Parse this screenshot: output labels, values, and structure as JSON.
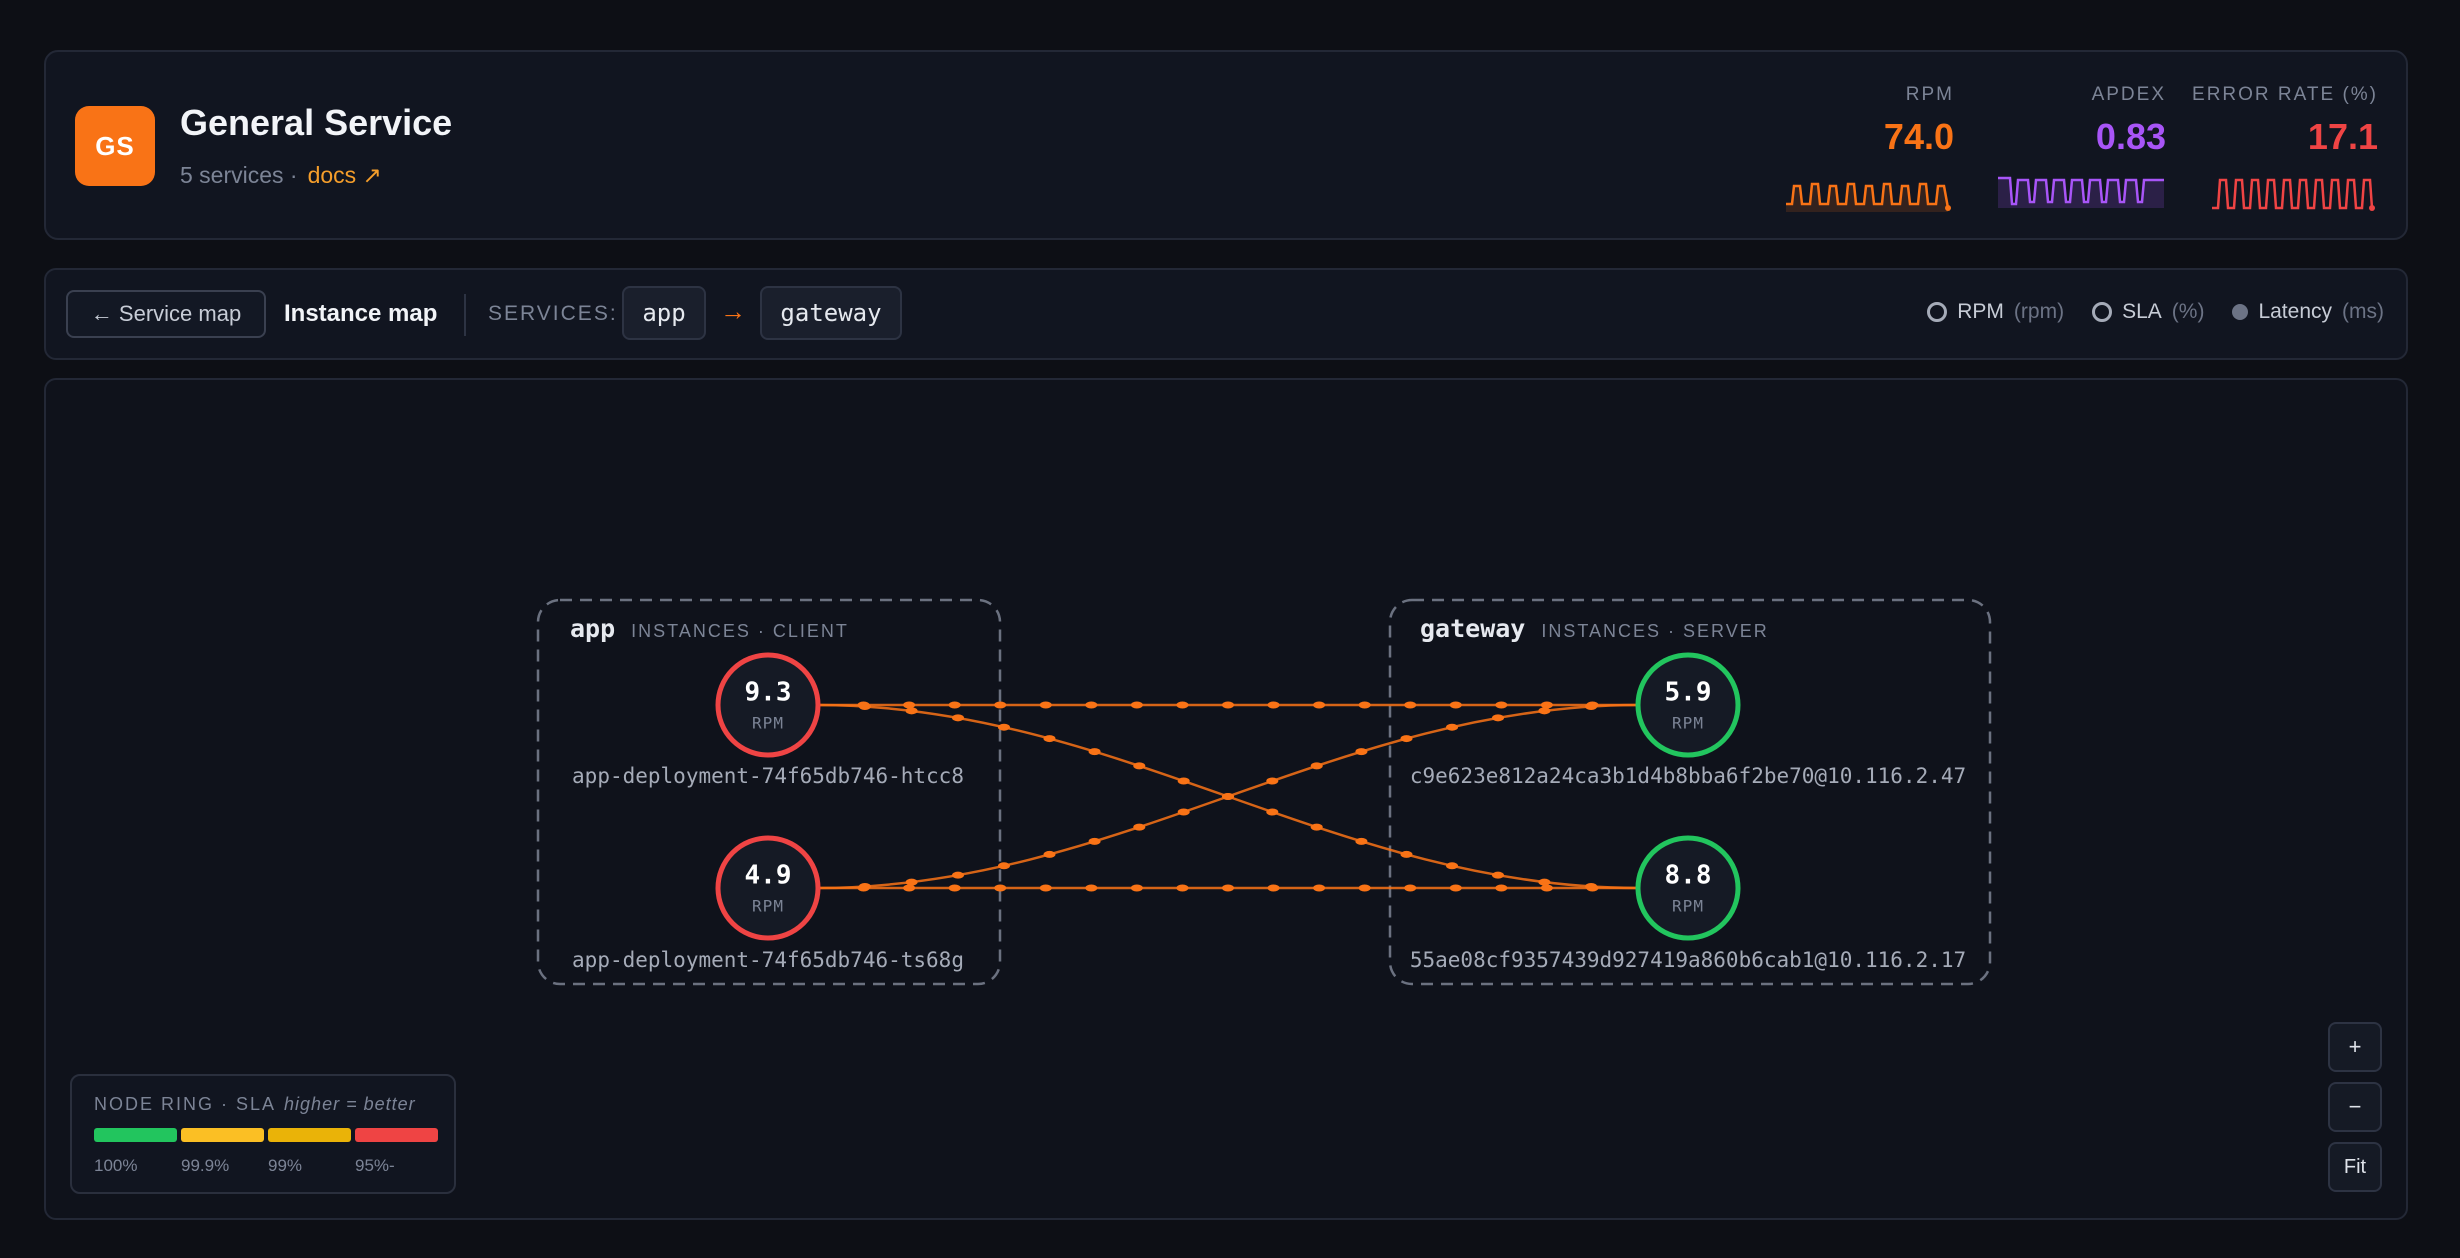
{
  "header": {
    "logo_text": "GS",
    "title": "General Service",
    "services_count": "5 services ·",
    "docs_link": "docs ↗",
    "kpis": [
      {
        "label": "RPM",
        "value": "74.0",
        "color": "#f97316"
      },
      {
        "label": "APDEX",
        "value": "0.83",
        "color": "#a855f7"
      },
      {
        "label": "ERROR RATE (%)",
        "value": "17.1",
        "color": "#ef4444"
      }
    ]
  },
  "toolbar": {
    "back_label": "← Service map",
    "current_label": "Instance map",
    "services_label": "SERVICES:",
    "service_from": "app",
    "service_arrow": "→",
    "service_to": "gateway",
    "metric_toggles": [
      {
        "label": "RPM",
        "unit": "(rpm)"
      },
      {
        "label": "SLA",
        "unit": "(%)"
      },
      {
        "label": "Latency",
        "unit": "(ms)"
      }
    ]
  },
  "groups": {
    "client": {
      "name": "app",
      "tag": "INSTANCES · CLIENT"
    },
    "server": {
      "name": "gateway",
      "tag": "INSTANCES · SERVER"
    }
  },
  "nodes": [
    {
      "value": "9.3",
      "unit": "RPM",
      "label": "app-deployment-74f65db746-htcc8",
      "ring_color": "#ef4444"
    },
    {
      "value": "4.9",
      "unit": "RPM",
      "label": "app-deployment-74f65db746-ts68g",
      "ring_color": "#ef4444"
    },
    {
      "value": "5.9",
      "unit": "RPM",
      "label": "c9e623e812a24ca3b1d4b8bba6f2be70@10.116.2.47",
      "ring_color": "#22c55e"
    },
    {
      "value": "8.8",
      "unit": "RPM",
      "label": "55ae08cf9357439d927419a860b6cab1@10.116.2.17",
      "ring_color": "#22c55e"
    }
  ],
  "edge_color": "#f97316",
  "legend": {
    "title": "NODE RING · SLA",
    "hint": "higher = better",
    "stops": [
      {
        "label": "100%",
        "color": "#22c55e"
      },
      {
        "label": "99.9%",
        "color": "#fbbf24"
      },
      {
        "label": "99%",
        "color": "#eab308"
      },
      {
        "label": "95%-",
        "color": "#ef4444"
      }
    ]
  },
  "zoom": {
    "in": "+",
    "out": "−",
    "fit": "Fit"
  }
}
